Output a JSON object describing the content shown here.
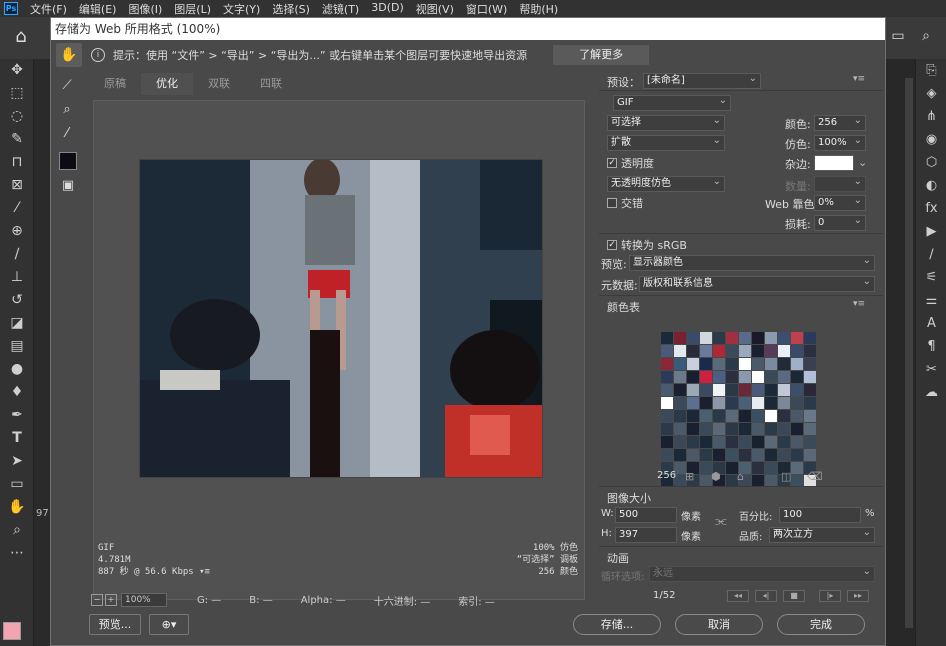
{
  "menubar": {
    "items": [
      "文件(F)",
      "编辑(E)",
      "图像(I)",
      "图层(L)",
      "文字(Y)",
      "选择(S)",
      "滤镜(T)",
      "3D(D)",
      "视图(V)",
      "窗口(W)",
      "帮助(H)"
    ]
  },
  "dialog": {
    "title": "存储为 Web 所用格式 (100%)",
    "hint": "提示：使用 “文件” > “导出” > “导出为...” 或右键单击某个图层可要快速地导出资源",
    "learn_more": "了解更多",
    "tabs": [
      "原稿",
      "优化",
      "双联",
      "四联"
    ],
    "info_left": [
      "GIF",
      "4.781M",
      "887 秒 @ 56.6 Kbps"
    ],
    "info_right": [
      "100% 仿色",
      "“可选择” 调板",
      "256 颜色"
    ],
    "status": {
      "zoom": "100%",
      "g": "G: —",
      "b": "B: —",
      "alpha": "Alpha: —",
      "hex": "十六进制: —",
      "index": "索引: —"
    },
    "buttons": {
      "preview": "预览...",
      "save": "存储...",
      "cancel": "取消",
      "done": "完成"
    },
    "settings": {
      "preset_label": "预设：",
      "preset": "[未命名]",
      "format": "GIF",
      "reduction": "可选择",
      "colors_label": "颜色:",
      "colors": "256",
      "dither_algo": "扩散",
      "dither_label": "仿色:",
      "dither": "100%",
      "transparency": "透明度",
      "matte_label": "杂边:",
      "trans_dither": "无透明度仿色",
      "amount_label": "数量:",
      "interlaced": "交错",
      "websnap_label": "Web 靠色:",
      "websnap": "0%",
      "lossy_label": "损耗:",
      "lossy": "0",
      "convert_srgb": "转换为 sRGB",
      "preview_label": "预览:",
      "preview": "显示器颜色",
      "metadata_label": "元数据:",
      "metadata": "版权和联系信息",
      "color_table_label": "颜色表",
      "color_count": "256",
      "image_size_label": "图像大小",
      "w_label": "W:",
      "w": "500",
      "h_label": "H:",
      "h": "397",
      "px": "像素",
      "percent_label": "百分比:",
      "percent": "100",
      "pct_unit": "%",
      "quality_label": "品质:",
      "quality": "两次立方",
      "anim_label": "动画",
      "loop_label": "循环选项:",
      "loop": "永远",
      "frame": "1/52"
    },
    "colors": {
      "matte": "#ffffff",
      "swatch": "#0c0c14"
    }
  },
  "color_table": [
    "#1a2a3a",
    "#7a2030",
    "#3a4a6a",
    "#cfd8e0",
    "#2a3a4a",
    "#a03040",
    "#5a6a8a",
    "#1a1a2a",
    "#8a9ab0",
    "#3a5070",
    "#c04050",
    "#2a3a5a",
    "#4a5a7a",
    "#e0e8f0",
    "#2a2a3a",
    "#6a7a9a",
    "#b02838",
    "#3a4a5a",
    "#9aa8c0",
    "#1a2030",
    "#5a3a5a",
    "#e8f0f8",
    "#3a4a6a",
    "#2a3040",
    "#8a2838",
    "#3a5a7a",
    "#c8d0e0",
    "#1a2a4a",
    "#5a6a7a",
    "#2a3a4a",
    "#ffffff",
    "#4a5a6a",
    "#7a8aa0",
    "#202a38",
    "#a0b0c8",
    "#3a4050",
    "#2a3a5a",
    "#6a7a8a",
    "#182030",
    "#d02040",
    "#4a6080",
    "#2a3040",
    "#8a98b0",
    "#ffffff",
    "#3a4a5a",
    "#5a6a80",
    "#1a2838",
    "#b0c0d8",
    "#4a5a70",
    "#1a2030",
    "#9aa8b8",
    "#3a4a60",
    "#f0f4f8",
    "#2a3848",
    "#6a2838",
    "#4a5a78",
    "#1a2a3a",
    "#c0c8d8",
    "#3a5068",
    "#2a2838",
    "#ffffff",
    "#3a4a5a",
    "#5a7090",
    "#1a2030",
    "#8a98a8",
    "#2a3a50",
    "#4a6078",
    "#e8ecf0",
    "#1a2838",
    "#7a8898",
    "#3a4858",
    "#2a3a4a",
    "#3a4a5a",
    "#2a3848",
    "#1a2838",
    "#4a6070",
    "#2a3a48",
    "#5a6a78",
    "#1a2030",
    "#3a5060",
    "#ffffff",
    "#2a3040",
    "#4a5868",
    "#6a7888",
    "#2a3a4a",
    "#4a5a6a",
    "#1a2030",
    "#3a4a58",
    "#5a6878",
    "#2a3848",
    "#1a2838",
    "#4a5868",
    "#2a3a48",
    "#3a4858",
    "#1a2030",
    "#5a6a7a",
    "#1a2030",
    "#3a4858",
    "#2a3a48",
    "#1a2838",
    "#4a5a68",
    "#2a3040",
    "#3a4a5a",
    "#1a2030",
    "#5a6878",
    "#2a3a4a",
    "#4a5868",
    "#3a4a58",
    "#3a4a5a",
    "#1a2838",
    "#4a5868",
    "#2a3a48",
    "#1a2030",
    "#3a5060",
    "#2a3040",
    "#4a5a6a",
    "#1a2838",
    "#3a4858",
    "#2a3a4a",
    "#5a6878",
    "#2a3a48",
    "#4a5a68",
    "#1a2030",
    "#3a4a58",
    "#2a3848",
    "#1a2030",
    "#4a6070",
    "#2a3040",
    "#3a4a5a",
    "#1a2838",
    "#5a6a7a",
    "#2a3a4a",
    "#1a2838",
    "#3a4a5a",
    "#2a3a4a",
    "#4a5868",
    "#1a2030",
    "#2a3848",
    "#3a4858",
    "#1a2030",
    "#4a5a6a",
    "#2a3a48",
    "#3a5060",
    "#e0e0e0"
  ]
}
